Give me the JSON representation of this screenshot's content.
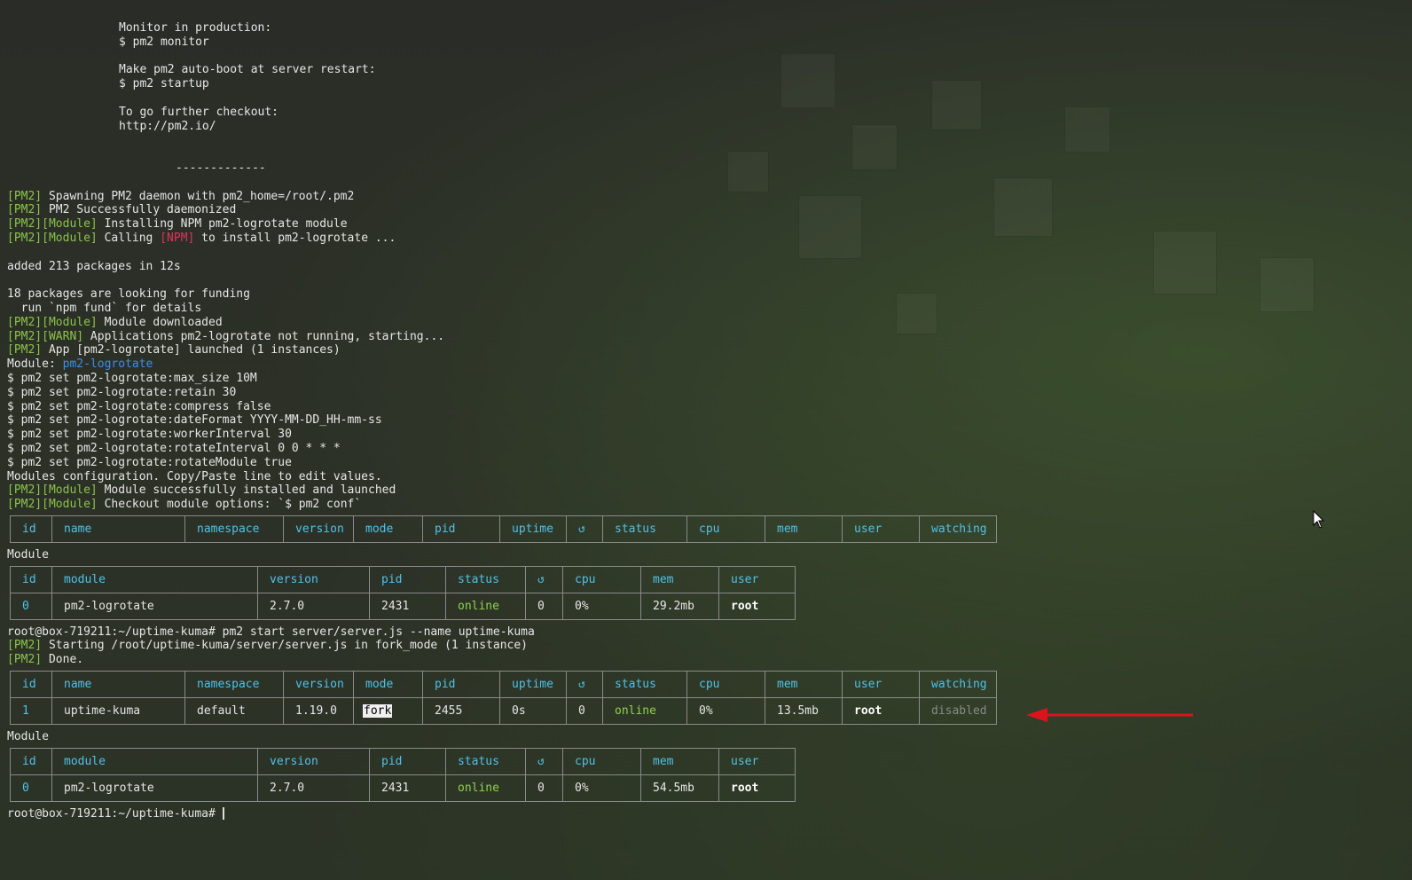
{
  "intro": {
    "monitor_label": "Monitor in production:",
    "monitor_cmd": "$ pm2 monitor",
    "startup_label": "Make pm2 auto-boot at server restart:",
    "startup_cmd": "$ pm2 startup",
    "further_label": "To go further checkout:",
    "url": "http://pm2.io/",
    "separator": "-------------"
  },
  "tags": {
    "pm2": "[PM2]",
    "module": "[Module]",
    "warn": "[WARN]",
    "npm": "[NPM]",
    "module_prefix": "Module: "
  },
  "log": {
    "spawn": " Spawning PM2 daemon with pm2_home=/root/.pm2",
    "daemonized": " PM2 Successfully daemonized",
    "installing": " Installing NPM pm2-logrotate module",
    "calling_pre": " Calling ",
    "calling_post": " to install pm2-logrotate ...",
    "added": "added 213 packages in 12s",
    "funding": "18 packages are looking for funding",
    "fund_hint": "  run `npm fund` for details",
    "downloaded": " Module downloaded",
    "not_running": " Applications pm2-logrotate not running, starting...",
    "launched": " App [pm2-logrotate] launched (1 instances)",
    "module_name": "pm2-logrotate",
    "set_cmds": [
      "$ pm2 set pm2-logrotate:max_size 10M",
      "$ pm2 set pm2-logrotate:retain 30",
      "$ pm2 set pm2-logrotate:compress false",
      "$ pm2 set pm2-logrotate:dateFormat YYYY-MM-DD_HH-mm-ss",
      "$ pm2 set pm2-logrotate:workerInterval 30",
      "$ pm2 set pm2-logrotate:rotateInterval 0 0 * * *",
      "$ pm2 set pm2-logrotate:rotateModule true"
    ],
    "modules_config": "Modules configuration. Copy/Paste line to edit values.",
    "installed": " Module successfully installed and launched",
    "checkout": " Checkout module options: `$ pm2 conf`",
    "prompt1": "root@box-719211:~/uptime-kuma# pm2 start server/server.js --name uptime-kuma",
    "starting": " Starting /root/uptime-kuma/server/server.js in fork_mode (1 instance)",
    "done": " Done.",
    "prompt2": "root@box-719211:~/uptime-kuma# "
  },
  "section_module": "Module",
  "app_headers": [
    "id",
    "name",
    "namespace",
    "version",
    "mode",
    "pid",
    "uptime",
    "↺",
    "status",
    "cpu",
    "mem",
    "user",
    "watching"
  ],
  "module_headers": [
    "id",
    "module",
    "version",
    "pid",
    "status",
    "↺",
    "cpu",
    "mem",
    "user"
  ],
  "app_row": {
    "id": "1",
    "name": "uptime-kuma",
    "namespace": "default",
    "version": "1.19.0",
    "mode": "fork",
    "pid": "2455",
    "uptime": "0s",
    "restarts": "0",
    "status": "online",
    "cpu": "0%",
    "mem": "13.5mb",
    "user": "root",
    "watching": "disabled"
  },
  "module_row_1": {
    "id": "0",
    "module": "pm2-logrotate",
    "version": "2.7.0",
    "pid": "2431",
    "status": "online",
    "restarts": "0",
    "cpu": "0%",
    "mem": "29.2mb",
    "user": "root"
  },
  "module_row_2": {
    "id": "0",
    "module": "pm2-logrotate",
    "version": "2.7.0",
    "pid": "2431",
    "status": "online",
    "restarts": "0",
    "cpu": "0%",
    "mem": "54.5mb",
    "user": "root"
  },
  "colors": {
    "tag": "#8bc34a",
    "npm": "#e0325a",
    "header": "#4fc1e9",
    "online": "#8fd14f",
    "arrow": "#d9141c"
  }
}
